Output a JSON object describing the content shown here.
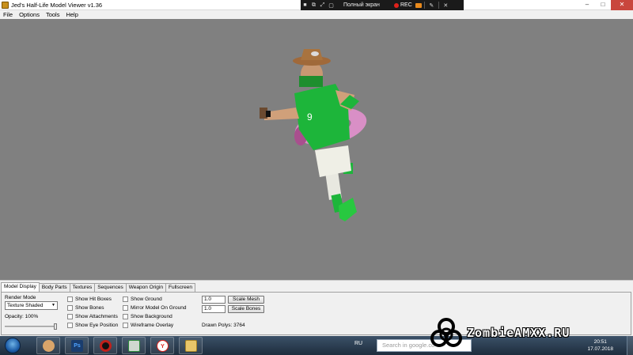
{
  "window": {
    "title": "Jed's Half-Life Model Viewer v1.36",
    "minimize_glyph": "–",
    "maximize_glyph": "□",
    "close_glyph": "✕"
  },
  "recorder": {
    "fullscreen_label": "Полный экран",
    "rec_label": "REC",
    "icons": [
      "record-stop-icon",
      "window-icon",
      "resize-icon",
      "capture-icon"
    ],
    "close_glyph": "✕"
  },
  "menu": {
    "file": "File",
    "options": "Options",
    "tools": "Tools",
    "help": "Help"
  },
  "tabs": [
    "Model Display",
    "Body Parts",
    "Textures",
    "Sequences",
    "Weapon Origin",
    "Fullscreen"
  ],
  "active_tab": "Model Display",
  "model_display": {
    "render_mode_label": "Render Mode",
    "render_mode_value": "Texture Shaded",
    "opacity_label": "Opacity: 100%",
    "opacity_value": 1.0,
    "col1": [
      "Show Hit Boxes",
      "Show Bones",
      "Show Attachments",
      "Show Eye Position"
    ],
    "col2": [
      "Show Ground",
      "Mirror Model On Ground",
      "Show Background",
      "Wireframe Overlay"
    ],
    "scale_mesh_value": "1.0",
    "scale_mesh_button": "Scale Mesh",
    "scale_bones_value": "1.0",
    "scale_bones_button": "Scale Bones",
    "drawn_polys": "Drawn Polys: 3764"
  },
  "taskbar": {
    "apps": [
      "explorer-icon",
      "photoshop-icon",
      "recorder-icon",
      "monitor-icon",
      "yandex-browser-icon",
      "folder-icon"
    ],
    "ps_label": "Ps",
    "y_label": "Y",
    "lang": "RU",
    "search_placeholder": "Search in google.co",
    "time": "20:51",
    "date": "17.07.2018"
  },
  "watermark": {
    "text": "ZombieAMXX.RU"
  },
  "colors": {
    "viewport_bg": "#808080",
    "jersey": "#1db53a",
    "hat": "#a0693a",
    "float_ring": "#d98fc6"
  }
}
